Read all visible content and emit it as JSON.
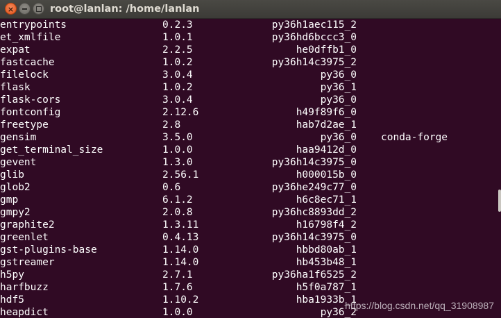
{
  "window": {
    "title": "root@lanlan: /home/lanlan",
    "close_glyph": "×",
    "colors": {
      "terminal_bg": "#300a24",
      "text": "#ffffff",
      "titlebar": "#3c3b37",
      "close_button": "#e95420"
    }
  },
  "packages": [
    {
      "name": "entrypoints",
      "version": "0.2.3",
      "build": "py36h1aec115_2",
      "channel": ""
    },
    {
      "name": "et_xmlfile",
      "version": "1.0.1",
      "build": "py36hd6bccc3_0",
      "channel": ""
    },
    {
      "name": "expat",
      "version": "2.2.5",
      "build": "he0dffb1_0",
      "channel": ""
    },
    {
      "name": "fastcache",
      "version": "1.0.2",
      "build": "py36h14c3975_2",
      "channel": ""
    },
    {
      "name": "filelock",
      "version": "3.0.4",
      "build": "py36_0",
      "channel": ""
    },
    {
      "name": "flask",
      "version": "1.0.2",
      "build": "py36_1",
      "channel": ""
    },
    {
      "name": "flask-cors",
      "version": "3.0.4",
      "build": "py36_0",
      "channel": ""
    },
    {
      "name": "fontconfig",
      "version": "2.12.6",
      "build": "h49f89f6_0",
      "channel": ""
    },
    {
      "name": "freetype",
      "version": "2.8",
      "build": "hab7d2ae_1",
      "channel": ""
    },
    {
      "name": "gensim",
      "version": "3.5.0",
      "build": "py36_0",
      "channel": "conda-forge"
    },
    {
      "name": "get_terminal_size",
      "version": "1.0.0",
      "build": "haa9412d_0",
      "channel": ""
    },
    {
      "name": "gevent",
      "version": "1.3.0",
      "build": "py36h14c3975_0",
      "channel": ""
    },
    {
      "name": "glib",
      "version": "2.56.1",
      "build": "h000015b_0",
      "channel": ""
    },
    {
      "name": "glob2",
      "version": "0.6",
      "build": "py36he249c77_0",
      "channel": ""
    },
    {
      "name": "gmp",
      "version": "6.1.2",
      "build": "h6c8ec71_1",
      "channel": ""
    },
    {
      "name": "gmpy2",
      "version": "2.0.8",
      "build": "py36hc8893dd_2",
      "channel": ""
    },
    {
      "name": "graphite2",
      "version": "1.3.11",
      "build": "h16798f4_2",
      "channel": ""
    },
    {
      "name": "greenlet",
      "version": "0.4.13",
      "build": "py36h14c3975_0",
      "channel": ""
    },
    {
      "name": "gst-plugins-base",
      "version": "1.14.0",
      "build": "hbbd80ab_1",
      "channel": ""
    },
    {
      "name": "gstreamer",
      "version": "1.14.0",
      "build": "hb453b48_1",
      "channel": ""
    },
    {
      "name": "h5py",
      "version": "2.7.1",
      "build": "py36ha1f6525_2",
      "channel": ""
    },
    {
      "name": "harfbuzz",
      "version": "1.7.6",
      "build": "h5f0a787_1",
      "channel": ""
    },
    {
      "name": "hdf5",
      "version": "1.10.2",
      "build": "hba1933b_1",
      "channel": ""
    },
    {
      "name": "heapdict",
      "version": "1.0.0",
      "build": "py36_2",
      "channel": ""
    }
  ],
  "watermark": "https://blog.csdn.net/qq_31908987"
}
